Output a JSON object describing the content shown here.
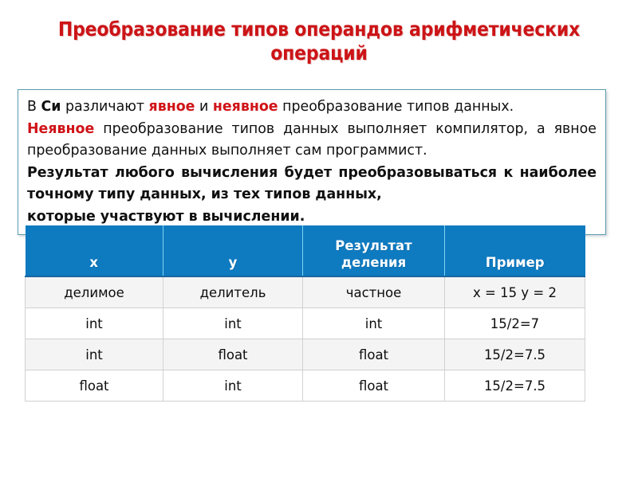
{
  "slide": {
    "title": "Преобразование типов операндов арифметических операций",
    "title_color": "#cc1417"
  },
  "callout": {
    "border_color": "#5b9bb0",
    "accent_color": "#d01418",
    "paragraph1": {
      "seg1": "В ",
      "seg2_bold": "Си",
      "seg3": " различают ",
      "seg4_red": "явное",
      "seg5": " и ",
      "seg6_red": "неявное",
      "seg7": " преобразование типов данных."
    },
    "paragraph2": {
      "seg1_red": "Неявное",
      "seg2": " преобразование типов данных выполняет компилятор, а явное преобразование данных выполняет сам программист."
    },
    "paragraph3": {
      "text": "Результат любого вычисления будет преобразовываться к наиболее точному типу данных, из тех типов данных,"
    },
    "paragraph4": {
      "text": "которые участвуют в вычислении."
    }
  },
  "table": {
    "header_bg": "#0e7ac0",
    "header_text_color": "#ffffff",
    "headers": [
      "x",
      "y",
      "Результат деления",
      "Пример"
    ],
    "headers_multiline": {
      "col3_line1": "Результат",
      "col3_line2": "деления"
    },
    "rows": [
      [
        "делимое",
        "делитель",
        "частное",
        "x = 15 y = 2"
      ],
      [
        "int",
        "int",
        "int",
        "15/2=7"
      ],
      [
        "int",
        "float",
        "float",
        "15/2=7.5"
      ],
      [
        "float",
        "int",
        "float",
        "15/2=7.5"
      ]
    ]
  }
}
